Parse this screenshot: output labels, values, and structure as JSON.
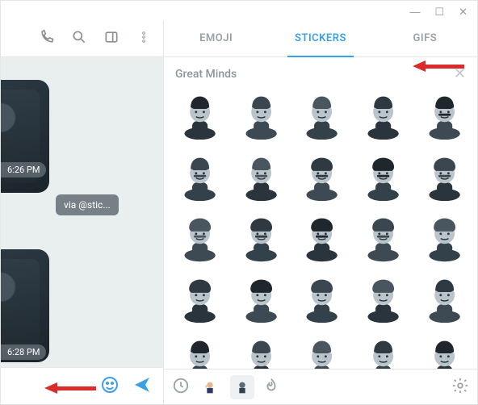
{
  "window": {
    "min": "—",
    "max": "☐",
    "close": "✕"
  },
  "chat": {
    "time1": "6:26 PM",
    "time2": "6:28 PM",
    "via": "via @stic..."
  },
  "tabs": {
    "emoji": "EMOJI",
    "stickers": "STICKERS",
    "gifs": "GIFS"
  },
  "pack": {
    "title": "Great Minds"
  },
  "sticker_count": 25
}
